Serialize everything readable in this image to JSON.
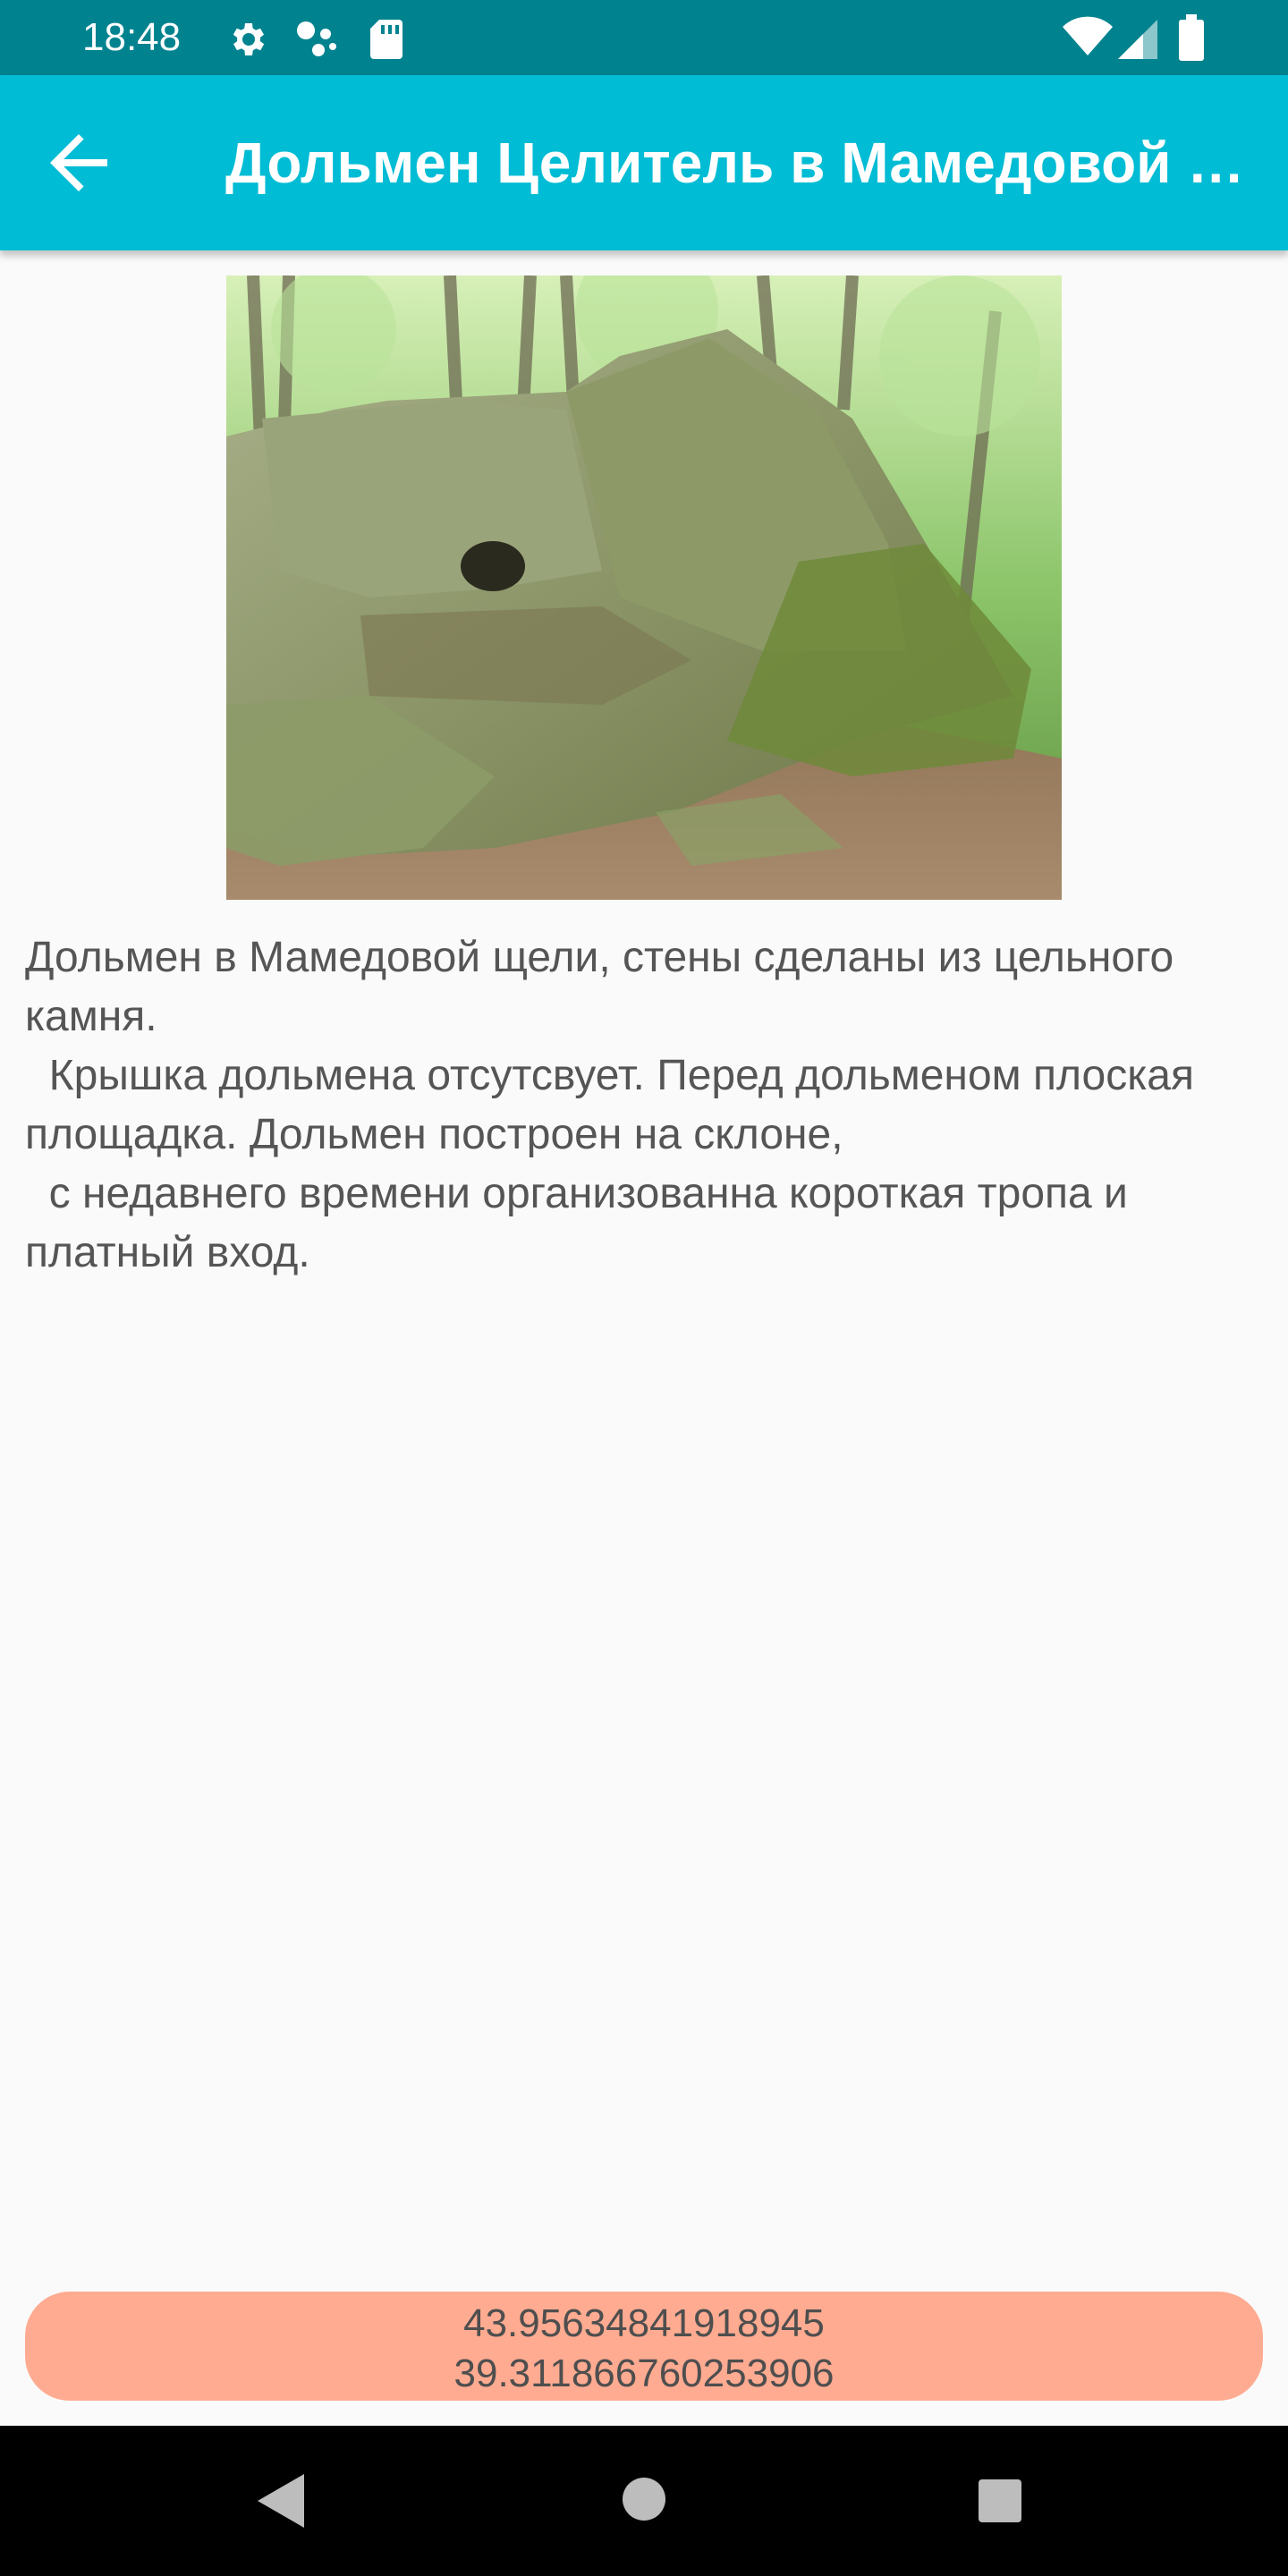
{
  "status_bar": {
    "time": "18:48",
    "icons": [
      "gear-icon",
      "assistant-dots-icon",
      "sd-card-icon",
      "wifi-icon",
      "signal-icon",
      "battery-icon"
    ],
    "background_color": "#00838f"
  },
  "app_bar": {
    "title": "Дольмен Целитель в Мамедовой щели",
    "back_icon": "arrow-back-icon",
    "background_color": "#00bcd4"
  },
  "photo": {
    "subject": "dolmen-photo"
  },
  "description": "Дольмен в Мамедовой щели, стены сделаны из цельного камня.\n  Крышка дольмена отсутсвует. Перед дольменом плоская площадка. Дольмен построен на склоне,\n  с недавнего времени организованна короткая тропа и платный вход.",
  "coordinates": {
    "latitude": "43.95634841918945",
    "longitude": "39.311866760253906",
    "background_color": "#ffab91"
  },
  "nav_bar": {
    "buttons": [
      "back-triangle-icon",
      "home-circle-icon",
      "recents-square-icon"
    ]
  }
}
